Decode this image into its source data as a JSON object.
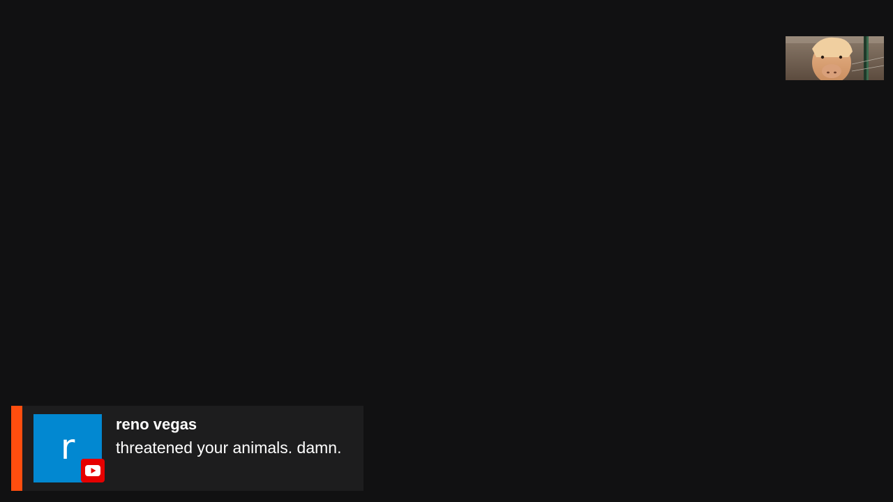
{
  "thumbnail": {
    "subject": "pony-photo"
  },
  "chat_highlight": {
    "accent_color": "#ff4e0f",
    "avatar_initial": "r",
    "avatar_color": "#0288d1",
    "platform_icon": "youtube-icon",
    "platform_color": "#e60000",
    "username": "reno vegas",
    "message": "threatened your animals. damn."
  }
}
